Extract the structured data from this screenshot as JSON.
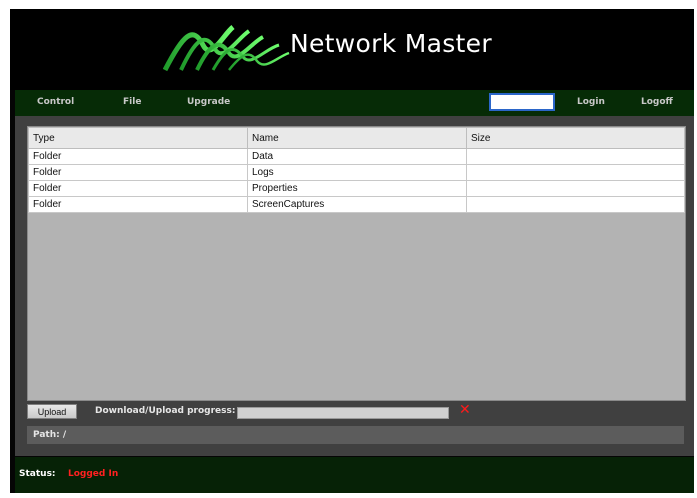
{
  "app": {
    "title": "Network Master"
  },
  "nav": {
    "items": [
      "Control",
      "File",
      "Upgrade"
    ],
    "login_label": "Login",
    "logoff_label": "Logoff",
    "login_input_value": ""
  },
  "file_table": {
    "columns": [
      "Type",
      "Name",
      "Size"
    ],
    "rows": [
      [
        "Folder",
        "Data",
        ""
      ],
      [
        "Folder",
        "Logs",
        ""
      ],
      [
        "Folder",
        "Properties",
        ""
      ],
      [
        "Folder",
        "ScreenCaptures",
        ""
      ]
    ]
  },
  "transfer": {
    "upload_label": "Upload",
    "progress_label": "Download/Upload progress:",
    "progress_fraction": 0
  },
  "path": {
    "label": "Path: /"
  },
  "status": {
    "label": "Status:",
    "value": "Logged In"
  },
  "colors": {
    "accent": "#2b66c9",
    "nav_bg": "#062b06",
    "logo_green": "#3fdc4a",
    "status_error": "#ff2020"
  },
  "icons": {
    "logo": "green-wave-logo",
    "cancel": "red-x-icon"
  }
}
